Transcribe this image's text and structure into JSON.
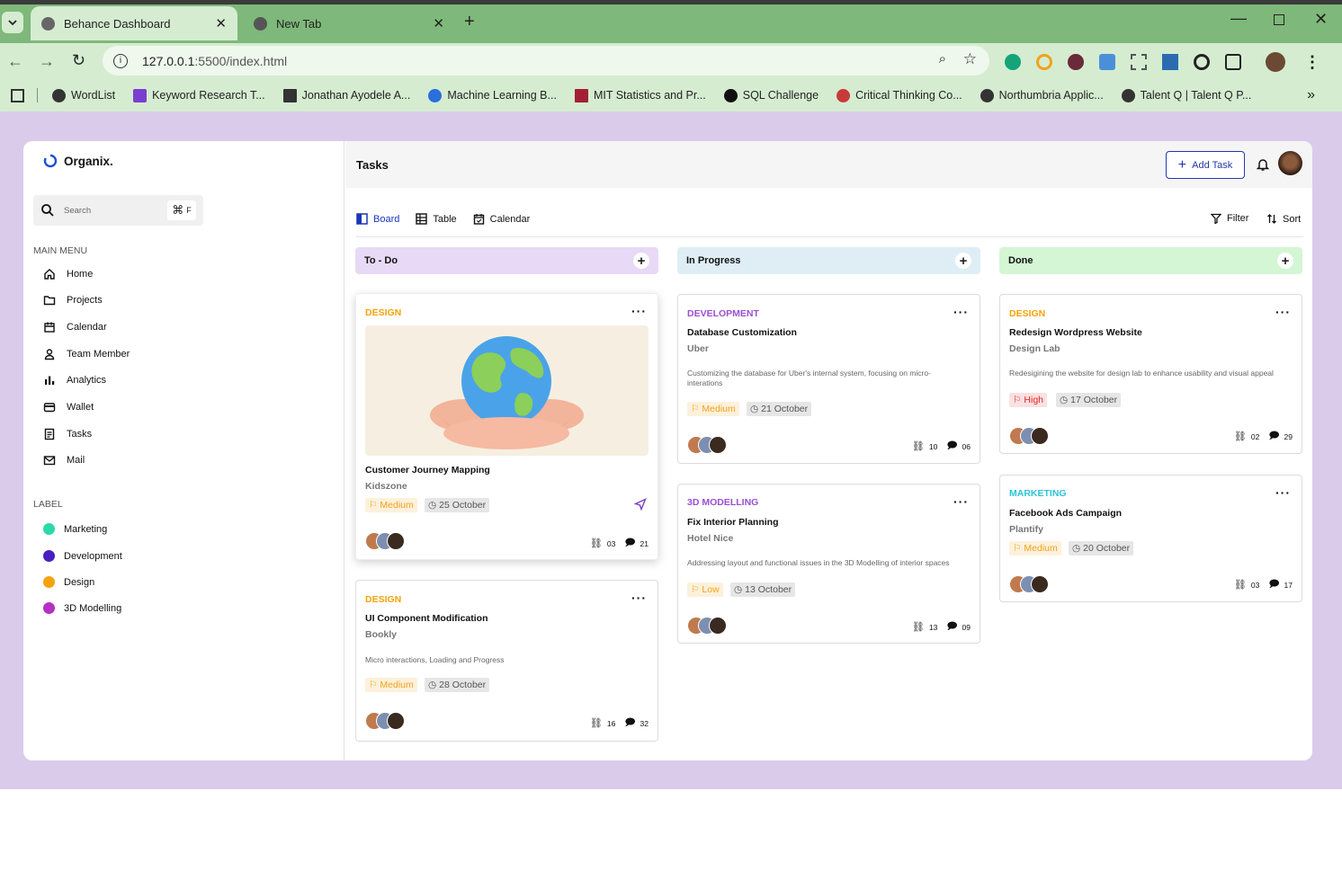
{
  "browser": {
    "tabs": [
      {
        "label": "Behance Dashboard"
      },
      {
        "label": "New Tab"
      }
    ],
    "url_host": "127.0.0.1",
    "url_rest": ":5500/index.html",
    "bookmarks": [
      {
        "label": "WordList"
      },
      {
        "label": "Keyword Research T..."
      },
      {
        "label": "Jonathan Ayodele A..."
      },
      {
        "label": "Machine Learning B..."
      },
      {
        "label": "MIT Statistics and Pr..."
      },
      {
        "label": "SQL Challenge"
      },
      {
        "label": "Critical Thinking Co..."
      },
      {
        "label": "Northumbria Applic..."
      },
      {
        "label": "Talent Q | Talent Q P..."
      }
    ]
  },
  "app": {
    "logo": "Organix.",
    "search_placeholder": "Search",
    "shortcut_key": "F",
    "main_menu_title": "MAIN MENU",
    "menu": [
      {
        "label": "Home"
      },
      {
        "label": "Projects"
      },
      {
        "label": "Calendar"
      },
      {
        "label": "Team Member"
      },
      {
        "label": "Analytics"
      },
      {
        "label": "Wallet"
      },
      {
        "label": "Tasks"
      },
      {
        "label": "Mail"
      }
    ],
    "label_title": "LABEL",
    "labels": [
      {
        "label": "Marketing",
        "color": "#2bd9a7"
      },
      {
        "label": "Development",
        "color": "#4a1fc2"
      },
      {
        "label": "Design",
        "color": "#f5a30c"
      },
      {
        "label": "3D Modelling",
        "color": "#b431c4"
      }
    ],
    "page_title": "Tasks",
    "add_task": "Add Task",
    "views": [
      {
        "label": "Board"
      },
      {
        "label": "Table"
      },
      {
        "label": "Calendar"
      }
    ],
    "filter": "Filter",
    "sort": "Sort",
    "columns": [
      {
        "title": "To - Do",
        "color": "#e8d9f6"
      },
      {
        "title": "In Progress",
        "color": "#dfeef5"
      },
      {
        "title": "Done",
        "color": "#d4f6d4"
      }
    ],
    "cards": [
      {
        "tag": "DESIGN",
        "tag_color": "#f5a30c",
        "title": "Customer Journey Mapping",
        "client": "Kidszone",
        "priority": "Medium",
        "date": "25 October",
        "links": "03",
        "comments": "21"
      },
      {
        "tag": "DESIGN",
        "tag_color": "#f5a30c",
        "title": "UI Component Modification",
        "client": "Bookly",
        "desc": "Micro interactions, Loading and Progress",
        "priority": "Medium",
        "date": "28 October",
        "links": "16",
        "comments": "32"
      },
      {
        "tag": "DEVELOPMENT",
        "tag_color": "#9b4fd1",
        "title": "Database Customization",
        "client": "Uber",
        "desc": "Customizing the database for Uber's internal system, focusing on micro-interations",
        "priority": "Medium",
        "date": "21 October",
        "links": "10",
        "comments": "06"
      },
      {
        "tag": "3D MODELLING",
        "tag_color": "#9b4fd1",
        "title": "Fix Interior Planning",
        "client": "Hotel Nice",
        "desc": "Addressing layout and functional issues in the 3D Modelling of interior spaces",
        "priority": "Low",
        "date": "13 October",
        "links": "13",
        "comments": "09"
      },
      {
        "tag": "DESIGN",
        "tag_color": "#f5a30c",
        "title": "Redesign Wordpress Website",
        "client": "Design Lab",
        "desc": "Redesigining the website for design lab to enhance usability and visual appeal",
        "priority": "High",
        "date": "17 October",
        "links": "02",
        "comments": "29"
      },
      {
        "tag": "MARKETING",
        "tag_color": "#2cc5d6",
        "title": "Facebook Ads Campaign",
        "client": "Plantify",
        "priority": "Medium",
        "date": "20 October",
        "links": "03",
        "comments": "17"
      }
    ]
  }
}
